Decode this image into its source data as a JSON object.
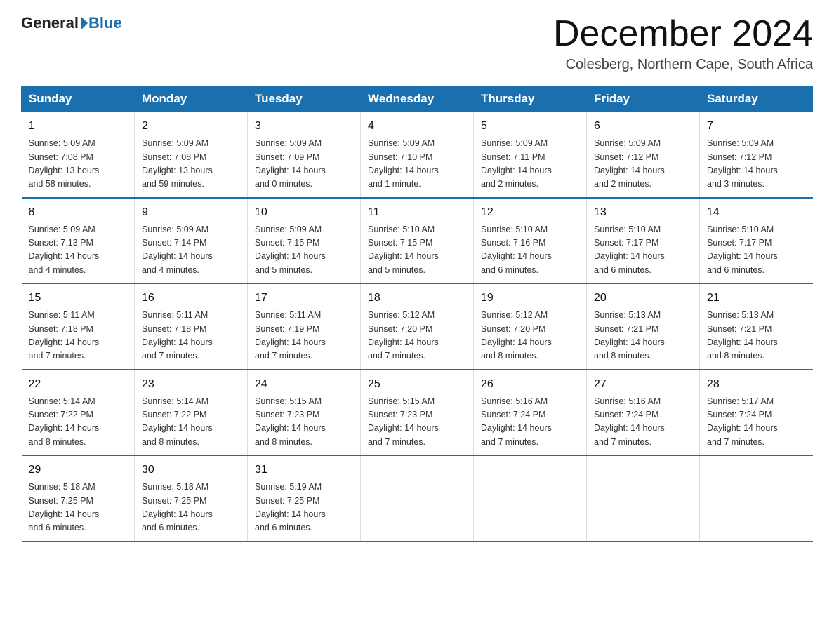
{
  "logo": {
    "general": "General",
    "blue": "Blue"
  },
  "header": {
    "month": "December 2024",
    "location": "Colesberg, Northern Cape, South Africa"
  },
  "weekdays": [
    "Sunday",
    "Monday",
    "Tuesday",
    "Wednesday",
    "Thursday",
    "Friday",
    "Saturday"
  ],
  "weeks": [
    [
      {
        "day": "1",
        "info": "Sunrise: 5:09 AM\nSunset: 7:08 PM\nDaylight: 13 hours\nand 58 minutes."
      },
      {
        "day": "2",
        "info": "Sunrise: 5:09 AM\nSunset: 7:08 PM\nDaylight: 13 hours\nand 59 minutes."
      },
      {
        "day": "3",
        "info": "Sunrise: 5:09 AM\nSunset: 7:09 PM\nDaylight: 14 hours\nand 0 minutes."
      },
      {
        "day": "4",
        "info": "Sunrise: 5:09 AM\nSunset: 7:10 PM\nDaylight: 14 hours\nand 1 minute."
      },
      {
        "day": "5",
        "info": "Sunrise: 5:09 AM\nSunset: 7:11 PM\nDaylight: 14 hours\nand 2 minutes."
      },
      {
        "day": "6",
        "info": "Sunrise: 5:09 AM\nSunset: 7:12 PM\nDaylight: 14 hours\nand 2 minutes."
      },
      {
        "day": "7",
        "info": "Sunrise: 5:09 AM\nSunset: 7:12 PM\nDaylight: 14 hours\nand 3 minutes."
      }
    ],
    [
      {
        "day": "8",
        "info": "Sunrise: 5:09 AM\nSunset: 7:13 PM\nDaylight: 14 hours\nand 4 minutes."
      },
      {
        "day": "9",
        "info": "Sunrise: 5:09 AM\nSunset: 7:14 PM\nDaylight: 14 hours\nand 4 minutes."
      },
      {
        "day": "10",
        "info": "Sunrise: 5:09 AM\nSunset: 7:15 PM\nDaylight: 14 hours\nand 5 minutes."
      },
      {
        "day": "11",
        "info": "Sunrise: 5:10 AM\nSunset: 7:15 PM\nDaylight: 14 hours\nand 5 minutes."
      },
      {
        "day": "12",
        "info": "Sunrise: 5:10 AM\nSunset: 7:16 PM\nDaylight: 14 hours\nand 6 minutes."
      },
      {
        "day": "13",
        "info": "Sunrise: 5:10 AM\nSunset: 7:17 PM\nDaylight: 14 hours\nand 6 minutes."
      },
      {
        "day": "14",
        "info": "Sunrise: 5:10 AM\nSunset: 7:17 PM\nDaylight: 14 hours\nand 6 minutes."
      }
    ],
    [
      {
        "day": "15",
        "info": "Sunrise: 5:11 AM\nSunset: 7:18 PM\nDaylight: 14 hours\nand 7 minutes."
      },
      {
        "day": "16",
        "info": "Sunrise: 5:11 AM\nSunset: 7:18 PM\nDaylight: 14 hours\nand 7 minutes."
      },
      {
        "day": "17",
        "info": "Sunrise: 5:11 AM\nSunset: 7:19 PM\nDaylight: 14 hours\nand 7 minutes."
      },
      {
        "day": "18",
        "info": "Sunrise: 5:12 AM\nSunset: 7:20 PM\nDaylight: 14 hours\nand 7 minutes."
      },
      {
        "day": "19",
        "info": "Sunrise: 5:12 AM\nSunset: 7:20 PM\nDaylight: 14 hours\nand 8 minutes."
      },
      {
        "day": "20",
        "info": "Sunrise: 5:13 AM\nSunset: 7:21 PM\nDaylight: 14 hours\nand 8 minutes."
      },
      {
        "day": "21",
        "info": "Sunrise: 5:13 AM\nSunset: 7:21 PM\nDaylight: 14 hours\nand 8 minutes."
      }
    ],
    [
      {
        "day": "22",
        "info": "Sunrise: 5:14 AM\nSunset: 7:22 PM\nDaylight: 14 hours\nand 8 minutes."
      },
      {
        "day": "23",
        "info": "Sunrise: 5:14 AM\nSunset: 7:22 PM\nDaylight: 14 hours\nand 8 minutes."
      },
      {
        "day": "24",
        "info": "Sunrise: 5:15 AM\nSunset: 7:23 PM\nDaylight: 14 hours\nand 8 minutes."
      },
      {
        "day": "25",
        "info": "Sunrise: 5:15 AM\nSunset: 7:23 PM\nDaylight: 14 hours\nand 7 minutes."
      },
      {
        "day": "26",
        "info": "Sunrise: 5:16 AM\nSunset: 7:24 PM\nDaylight: 14 hours\nand 7 minutes."
      },
      {
        "day": "27",
        "info": "Sunrise: 5:16 AM\nSunset: 7:24 PM\nDaylight: 14 hours\nand 7 minutes."
      },
      {
        "day": "28",
        "info": "Sunrise: 5:17 AM\nSunset: 7:24 PM\nDaylight: 14 hours\nand 7 minutes."
      }
    ],
    [
      {
        "day": "29",
        "info": "Sunrise: 5:18 AM\nSunset: 7:25 PM\nDaylight: 14 hours\nand 6 minutes."
      },
      {
        "day": "30",
        "info": "Sunrise: 5:18 AM\nSunset: 7:25 PM\nDaylight: 14 hours\nand 6 minutes."
      },
      {
        "day": "31",
        "info": "Sunrise: 5:19 AM\nSunset: 7:25 PM\nDaylight: 14 hours\nand 6 minutes."
      },
      null,
      null,
      null,
      null
    ]
  ]
}
